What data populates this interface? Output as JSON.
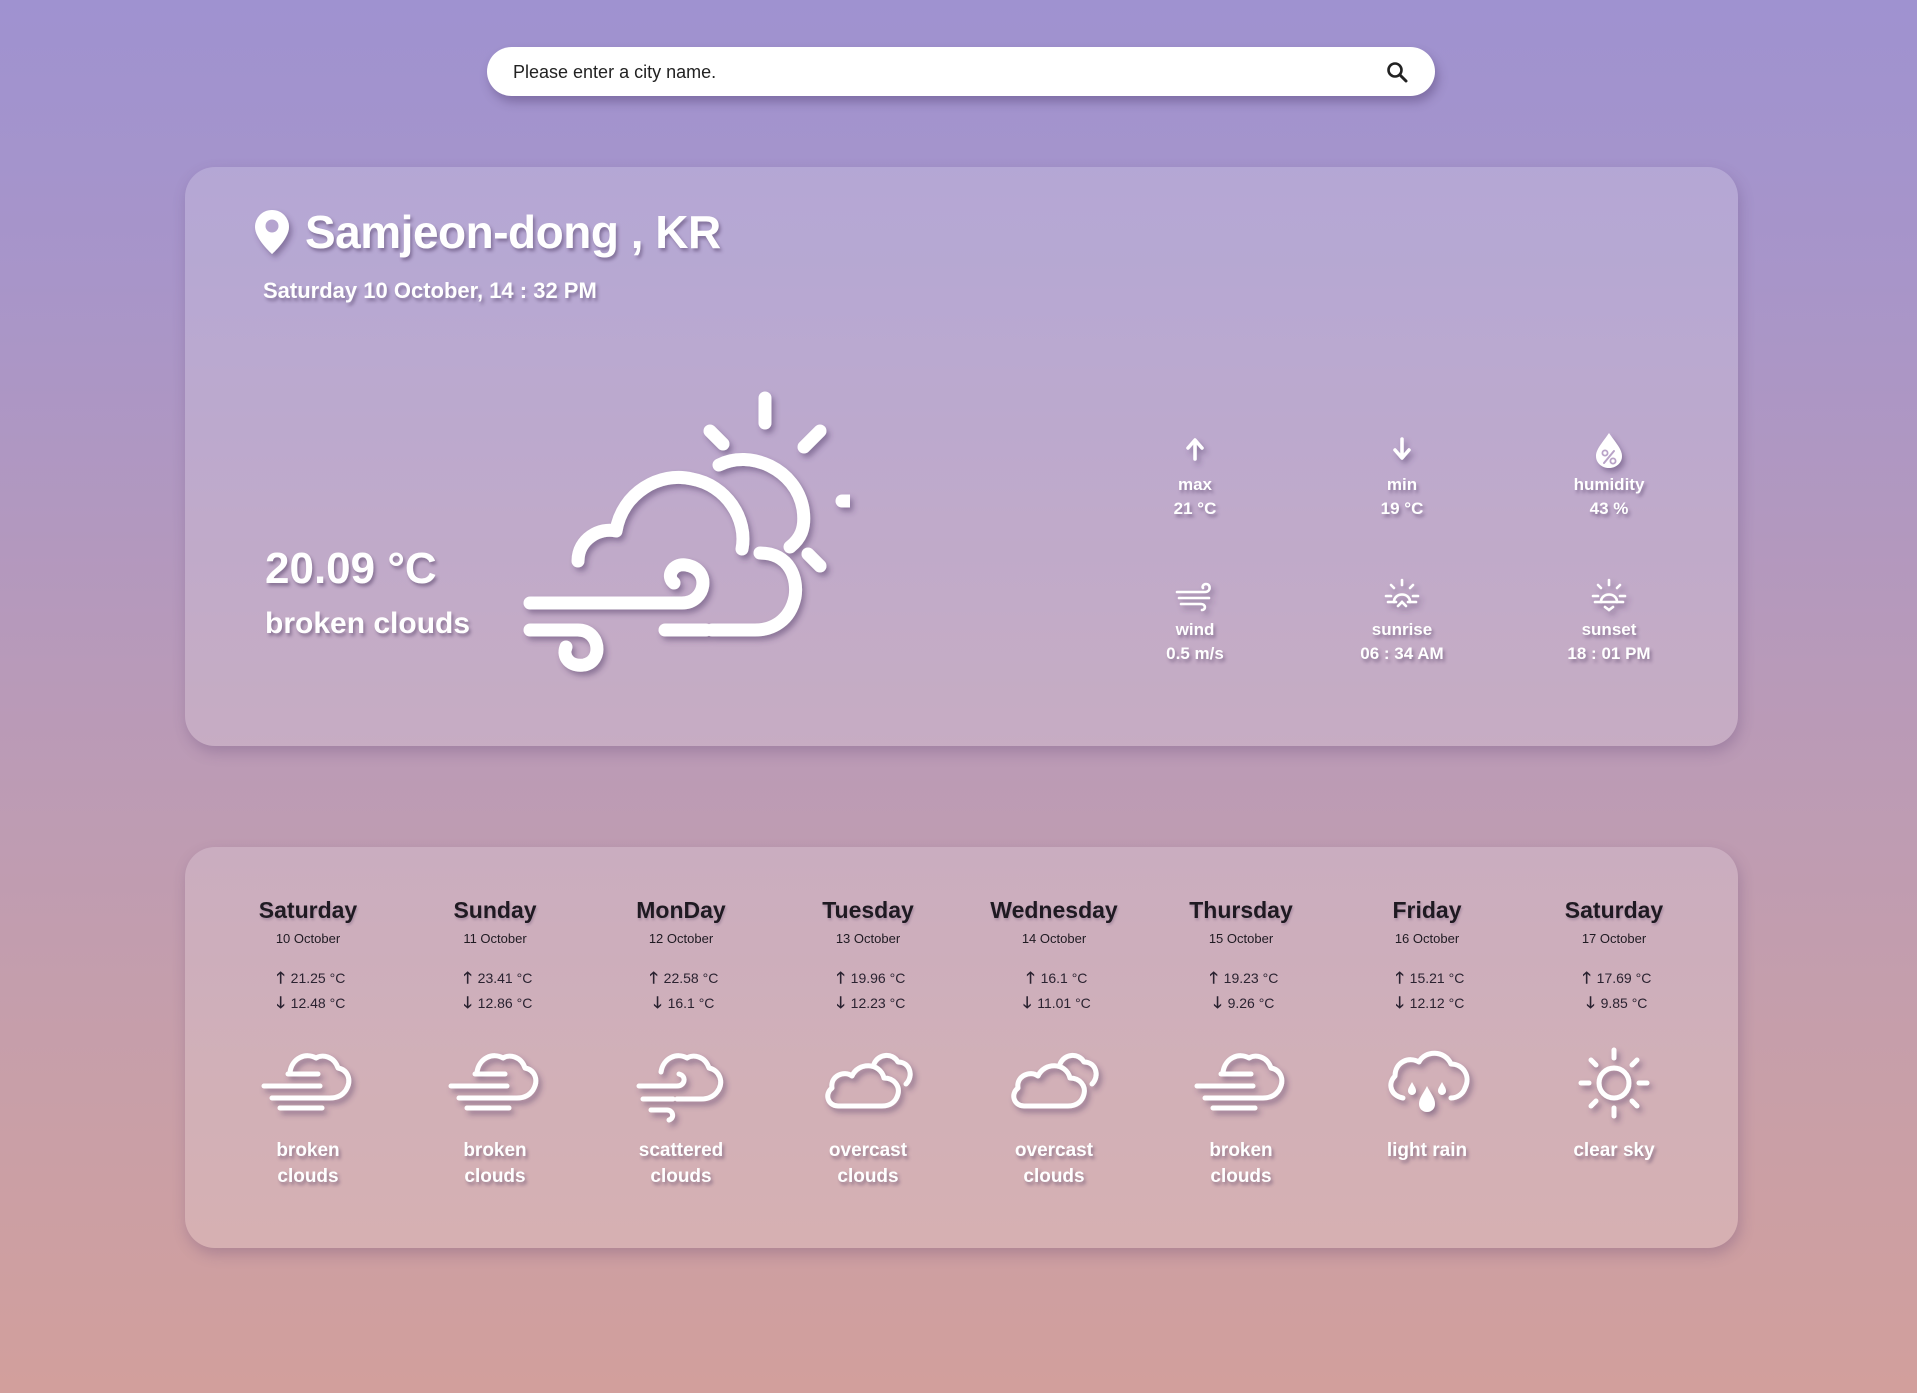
{
  "search": {
    "placeholder": "Please enter a city name.",
    "icon": "search-icon"
  },
  "current": {
    "location": "Samjeon-dong , KR",
    "datetime": "Saturday 10 October, 14 : 32 PM",
    "temperature": "20.09 °C",
    "description": "broken clouds",
    "icon": "partly-cloudy-windy-icon",
    "stats": [
      {
        "key": "max",
        "label": "max",
        "value": "21 °C",
        "icon": "arrow-up-icon"
      },
      {
        "key": "min",
        "label": "min",
        "value": "19 °C",
        "icon": "arrow-down-icon"
      },
      {
        "key": "humidity",
        "label": "humidity",
        "value": "43 %",
        "icon": "humidity-drop-icon"
      },
      {
        "key": "wind",
        "label": "wind",
        "value": "0.5 m/s",
        "icon": "wind-icon"
      },
      {
        "key": "sunrise",
        "label": "sunrise",
        "value": "06 : 34 AM",
        "icon": "sunrise-icon"
      },
      {
        "key": "sunset",
        "label": "sunset",
        "value": "18 : 01 PM",
        "icon": "sunset-icon"
      }
    ]
  },
  "forecast": [
    {
      "day": "Saturday",
      "date": "10 October",
      "max": "21.25 °C",
      "min": "12.48 °C",
      "desc": "broken clouds",
      "icon": "cloud-wind-icon"
    },
    {
      "day": "Sunday",
      "date": "11 October",
      "max": "23.41 °C",
      "min": "12.86 °C",
      "desc": "broken clouds",
      "icon": "cloud-wind-icon"
    },
    {
      "day": "MonDay",
      "date": "12 October",
      "max": "22.58 °C",
      "min": "16.1 °C",
      "desc": "scattered clouds",
      "icon": "cloud-swirl-icon"
    },
    {
      "day": "Tuesday",
      "date": "13 October",
      "max": "19.96 °C",
      "min": "12.23 °C",
      "desc": "overcast clouds",
      "icon": "clouds-icon"
    },
    {
      "day": "Wednesday",
      "date": "14 October",
      "max": "16.1 °C",
      "min": "11.01 °C",
      "desc": "overcast clouds",
      "icon": "clouds-icon"
    },
    {
      "day": "Thursday",
      "date": "15 October",
      "max": "19.23 °C",
      "min": "9.26 °C",
      "desc": "broken clouds",
      "icon": "cloud-wind-icon"
    },
    {
      "day": "Friday",
      "date": "16 October",
      "max": "15.21 °C",
      "min": "12.12 °C",
      "desc": "light rain",
      "icon": "cloud-rain-icon"
    },
    {
      "day": "Saturday",
      "date": "17 October",
      "max": "17.69 °C",
      "min": "9.85 °C",
      "desc": "clear sky",
      "icon": "sun-icon"
    }
  ],
  "arrows": {
    "up": "🡑",
    "down": "🡓"
  }
}
